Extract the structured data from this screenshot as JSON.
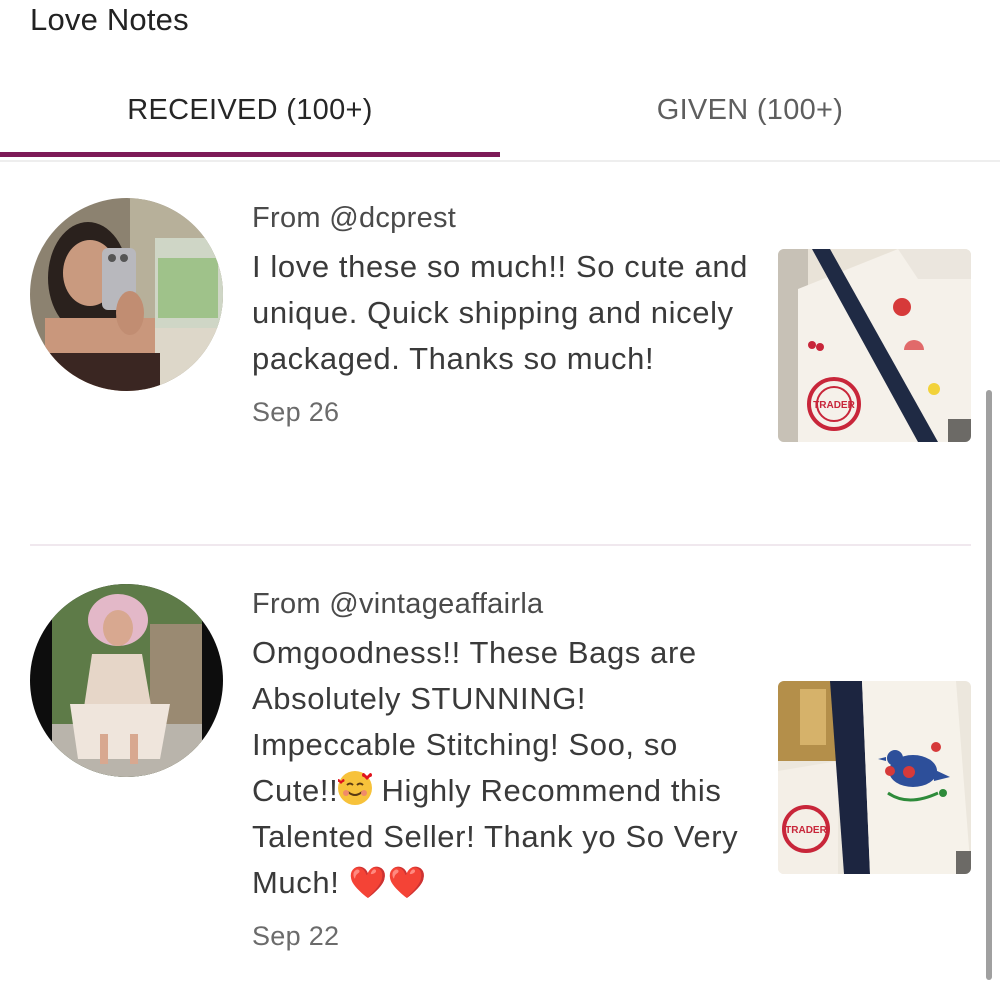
{
  "header": {
    "title": "Love Notes"
  },
  "tabs": [
    {
      "label": "RECEIVED (100+)",
      "active": true
    },
    {
      "label": "GIVEN (100+)",
      "active": false
    }
  ],
  "colors": {
    "accent": "#7d1a57",
    "heart": "#e0131d"
  },
  "notes": [
    {
      "from": "From @dcprest",
      "message": "I love these so much!! So cute and unique. Quick shipping and nicely packaged. Thanks so much!",
      "date": "Sep 26",
      "thumbnail_logo": "TRADER JOE'S"
    },
    {
      "from": "From @vintageaffairla",
      "message_before_emoji": "Omgoodness!! These Bags are Absolutely STUNNING! Impeccable Stitching! Soo, so Cute!!",
      "emoji_icon": "smiling-face-with-hearts-emoji",
      "message_after_emoji": " Highly Recommend this Talented Seller! Thank yo So Very Much! ",
      "hearts": "❤️❤️",
      "date": "Sep 22",
      "thumbnail_logo": "TRADER JOE'S"
    }
  ]
}
